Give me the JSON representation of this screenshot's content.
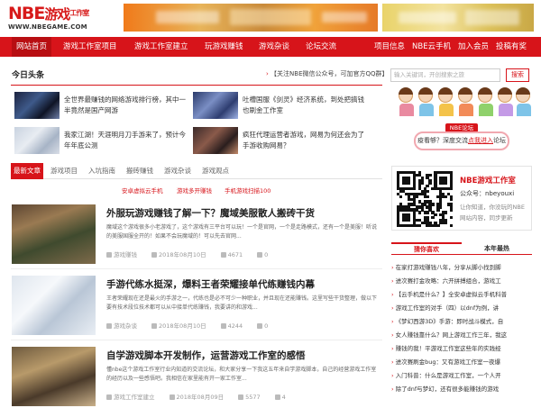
{
  "header": {
    "logo_main": "NBE",
    "logo_cn": "游戏",
    "logo_small": "工作室",
    "logo_url": "WWW.NBEGAME.COM"
  },
  "nav": {
    "left": [
      "网站首页",
      "游戏工作室项目",
      "游戏工作室建立",
      "玩游戏赚钱",
      "游戏杂谈",
      "论坛交流"
    ],
    "right": [
      "项目信息",
      "NBE云手机",
      "加入会员",
      "投稿有奖"
    ]
  },
  "headline": {
    "title": "今日头条",
    "notice": "【关注NBE微信公众号，可加官方QQ群】",
    "items": [
      "全世界最赚钱的网络游戏排行榜，其中一半竟然是国产网游",
      "吐槽国服《剑灵》经济系统，到处把搞钱也刷金工作室",
      "我家江湖！天涯明月刀手游来了，预计今年年底公测",
      "疯狂代理运营者游戏，网易为何还会为了手游收购网易？"
    ]
  },
  "tabs": [
    "最新文章",
    "游戏项目",
    "入坑指南",
    "搬砖赚钱",
    "游戏杂谈",
    "游戏观点"
  ],
  "sub_links": [
    "安卓虚拟云手机",
    "游戏多开赚钱",
    "手机游戏扫描100"
  ],
  "articles": [
    {
      "title": "外服玩游戏赚钱了解一下？魔域美服散人搬砖干货",
      "desc": "魔域这个游戏很多小老游戏了，这个游戏有三平台可以玩！一个是官网，一个是走路模式，还有一个是美服！听说的美服国服全开的！如果不会玩魔域的！可以先去官网...",
      "cat": "游戏赚钱",
      "date": "2018年08月10日",
      "views": "4671",
      "comments": "0"
    },
    {
      "title": "手游代练水挺深，爆料王者荣耀接单代练赚钱内幕",
      "desc": "王者荣耀现在还是最火的手游之一，代练也是必不可少一种职业，并且现在还能赚钱。这里写些干货整理，做以下要有技术段位技术都可以从中接单代练赚钱，我要讲的和游戏...",
      "cat": "游戏杂谈",
      "date": "2018年08月10日",
      "views": "4244",
      "comments": "0"
    },
    {
      "title": "自学游戏脚本开发制作，运营游戏工作室的感悟",
      "desc": "懂nbe这个游戏工作室行业内知道的交流论坛，和大家分享一下我这五年来自学游戏脚本，自己的经营游戏工作室的经历以及一些感悟吧。我相信在家里能有开一家工作室...",
      "cat": "游戏工作室建立",
      "date": "2018年08月09日",
      "views": "5577",
      "comments": "4"
    }
  ],
  "sidebar": {
    "search_placeholder": "输入关键词，开创搜索之旅",
    "search_btn": "搜索",
    "forum_tag": "NBE论坛",
    "forum_text_a": "疫看够？深度交流",
    "forum_text_link": "点我进入",
    "forum_text_b": "论坛",
    "wechat_title": "NBE游戏工作室",
    "wechat_id": "公众号：nbeyouxi",
    "wechat_line1": "让你知道，你没玩的NBE",
    "wechat_line2": "网站内容，同步更新",
    "rank_tabs": [
      "猜你喜欢",
      "本年最热"
    ],
    "rank_items": [
      "在家打游戏赚钱八年，分享从脚小找到脚",
      "进次赛打金攻略：六开拼搏组合，游戏工",
      "【云手机是什么？】全安卓虚拟云手机科普",
      "游戏工作室的对手（四）以dnf为例，讲",
      "《梦幻西游3D》手游：即时战斗模式，自",
      "女人赚钱靠什么？网上游戏工作三年，我这",
      "赚钱的我！平游戏工作室这些年的实践经",
      "进次赛刷金bug：又有游戏工作室一夜爆",
      "入门科普：什么是游戏工作室，一个人开",
      "除了dnf与梦幻，还有很多能赚钱的游戏"
    ]
  }
}
